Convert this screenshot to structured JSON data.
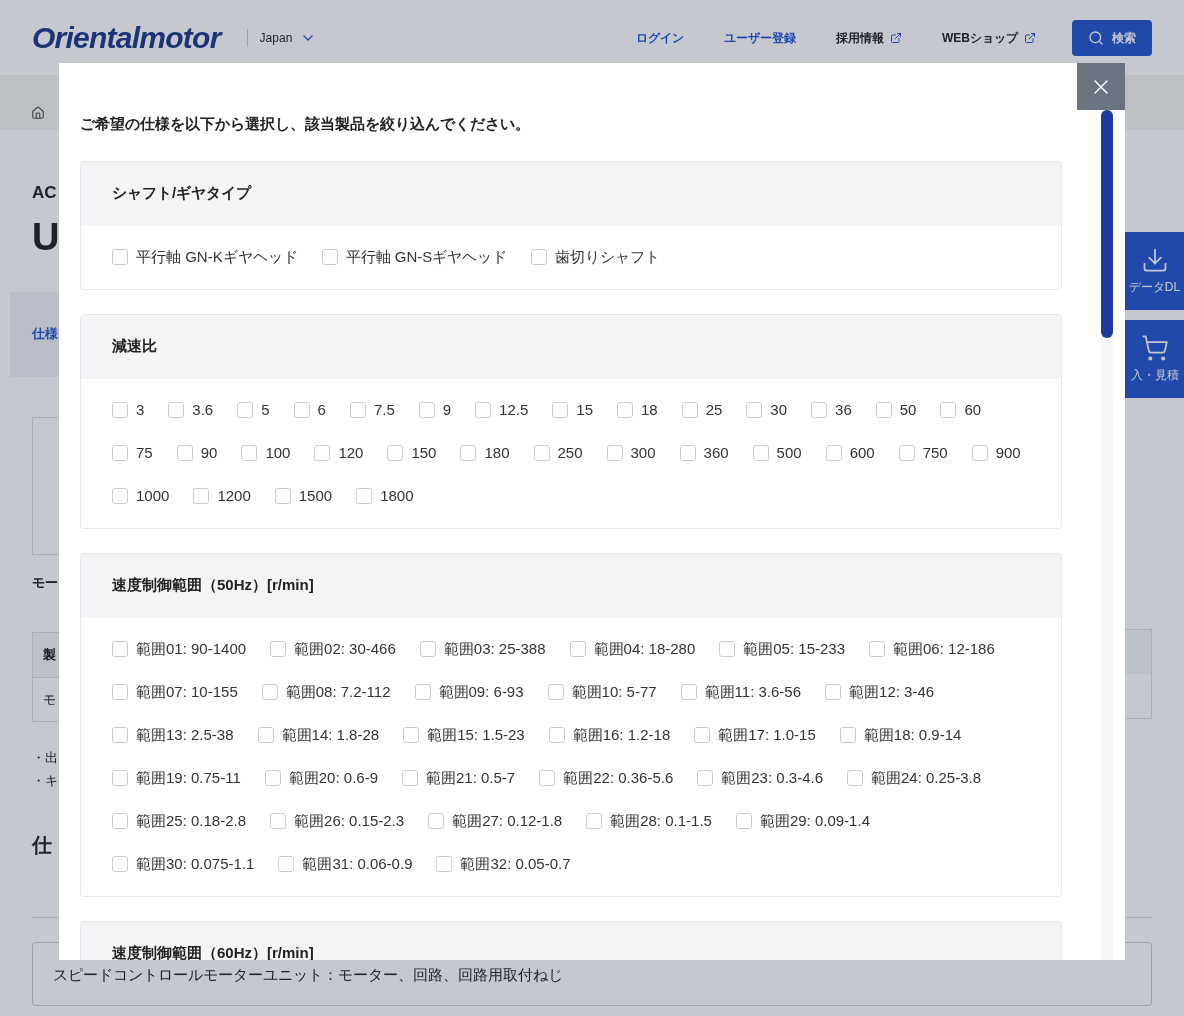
{
  "header": {
    "logo": "Orientalmotor",
    "region": "Japan",
    "nav": [
      {
        "label": "ログイン",
        "external": false
      },
      {
        "label": "ユーザー登録",
        "external": false
      },
      {
        "label": "採用情報",
        "external": true
      },
      {
        "label": "WEBショップ",
        "external": true
      }
    ],
    "search": "検索"
  },
  "page": {
    "category": "AC",
    "title": "U",
    "tab": "仕様",
    "subheading": "モー",
    "table_header": "製",
    "table_cell": "モ",
    "notes": [
      "・出",
      "・キ"
    ],
    "section_heading": "仕",
    "contents": "スピードコントロールモーターユニット：モーター、回路、回路用取付ねじ"
  },
  "side_buttons": [
    {
      "kind": "download",
      "label": "データDL"
    },
    {
      "kind": "cart",
      "label": "入・見積"
    }
  ],
  "modal": {
    "instruction": "ご希望の仕様を以下から選択し、該当製品を絞り込んでください。",
    "sections": [
      {
        "title": "シャフト/ギヤタイプ",
        "options": [
          {
            "label": "平行軸 GN-Kギヤヘッド",
            "checked": false
          },
          {
            "label": "平行軸 GN-Sギヤヘッド",
            "checked": false
          },
          {
            "label": "歯切りシャフト",
            "checked": false
          }
        ]
      },
      {
        "title": "減速比",
        "options": [
          {
            "label": "3",
            "checked": false
          },
          {
            "label": "3.6",
            "checked": false
          },
          {
            "label": "5",
            "checked": false
          },
          {
            "label": "6",
            "checked": false
          },
          {
            "label": "7.5",
            "checked": false
          },
          {
            "label": "9",
            "checked": false
          },
          {
            "label": "12.5",
            "checked": false
          },
          {
            "label": "15",
            "checked": false
          },
          {
            "label": "18",
            "checked": false
          },
          {
            "label": "25",
            "checked": false
          },
          {
            "label": "30",
            "checked": false
          },
          {
            "label": "36",
            "checked": false
          },
          {
            "label": "50",
            "checked": false
          },
          {
            "label": "60",
            "checked": false
          },
          {
            "label": "75",
            "checked": false
          },
          {
            "label": "90",
            "checked": false
          },
          {
            "label": "100",
            "checked": false
          },
          {
            "label": "120",
            "checked": false
          },
          {
            "label": "150",
            "checked": false
          },
          {
            "label": "180",
            "checked": false
          },
          {
            "label": "250",
            "checked": false
          },
          {
            "label": "300",
            "checked": false
          },
          {
            "label": "360",
            "checked": false
          },
          {
            "label": "500",
            "checked": false
          },
          {
            "label": "600",
            "checked": false
          },
          {
            "label": "750",
            "checked": false
          },
          {
            "label": "900",
            "checked": false
          },
          {
            "label": "1000",
            "checked": false
          },
          {
            "label": "1200",
            "checked": false
          },
          {
            "label": "1500",
            "checked": false
          },
          {
            "label": "1800",
            "checked": false
          }
        ]
      },
      {
        "title": "速度制御範囲（50Hz）[r/min]",
        "options": [
          {
            "label": "範囲01: 90-1400",
            "checked": false
          },
          {
            "label": "範囲02: 30-466",
            "checked": false
          },
          {
            "label": "範囲03: 25-388",
            "checked": false
          },
          {
            "label": "範囲04: 18-280",
            "checked": false
          },
          {
            "label": "範囲05: 15-233",
            "checked": false
          },
          {
            "label": "範囲06: 12-186",
            "checked": false
          },
          {
            "label": "範囲07: 10-155",
            "checked": false
          },
          {
            "label": "範囲08: 7.2-112",
            "checked": false
          },
          {
            "label": "範囲09: 6-93",
            "checked": false
          },
          {
            "label": "範囲10: 5-77",
            "checked": false
          },
          {
            "label": "範囲11: 3.6-56",
            "checked": false
          },
          {
            "label": "範囲12: 3-46",
            "checked": false
          },
          {
            "label": "範囲13: 2.5-38",
            "checked": false
          },
          {
            "label": "範囲14: 1.8-28",
            "checked": false
          },
          {
            "label": "範囲15: 1.5-23",
            "checked": false
          },
          {
            "label": "範囲16: 1.2-18",
            "checked": false
          },
          {
            "label": "範囲17: 1.0-15",
            "checked": false
          },
          {
            "label": "範囲18: 0.9-14",
            "checked": false
          },
          {
            "label": "範囲19: 0.75-11",
            "checked": false
          },
          {
            "label": "範囲20: 0.6-9",
            "checked": false
          },
          {
            "label": "範囲21: 0.5-7",
            "checked": false
          },
          {
            "label": "範囲22: 0.36-5.6",
            "checked": false
          },
          {
            "label": "範囲23: 0.3-4.6",
            "checked": false
          },
          {
            "label": "範囲24: 0.25-3.8",
            "checked": false
          },
          {
            "label": "範囲25: 0.18-2.8",
            "checked": false
          },
          {
            "label": "範囲26: 0.15-2.3",
            "checked": false
          },
          {
            "label": "範囲27: 0.12-1.8",
            "checked": false
          },
          {
            "label": "範囲28: 0.1-1.5",
            "checked": false
          },
          {
            "label": "範囲29: 0.09-1.4",
            "checked": false
          },
          {
            "label": "範囲30: 0.075-1.1",
            "checked": false
          },
          {
            "label": "範囲31: 0.06-0.9",
            "checked": false
          },
          {
            "label": "範囲32: 0.05-0.7",
            "checked": false
          }
        ]
      },
      {
        "title": "速度制御範囲（60Hz）[r/min]"
      }
    ]
  }
}
